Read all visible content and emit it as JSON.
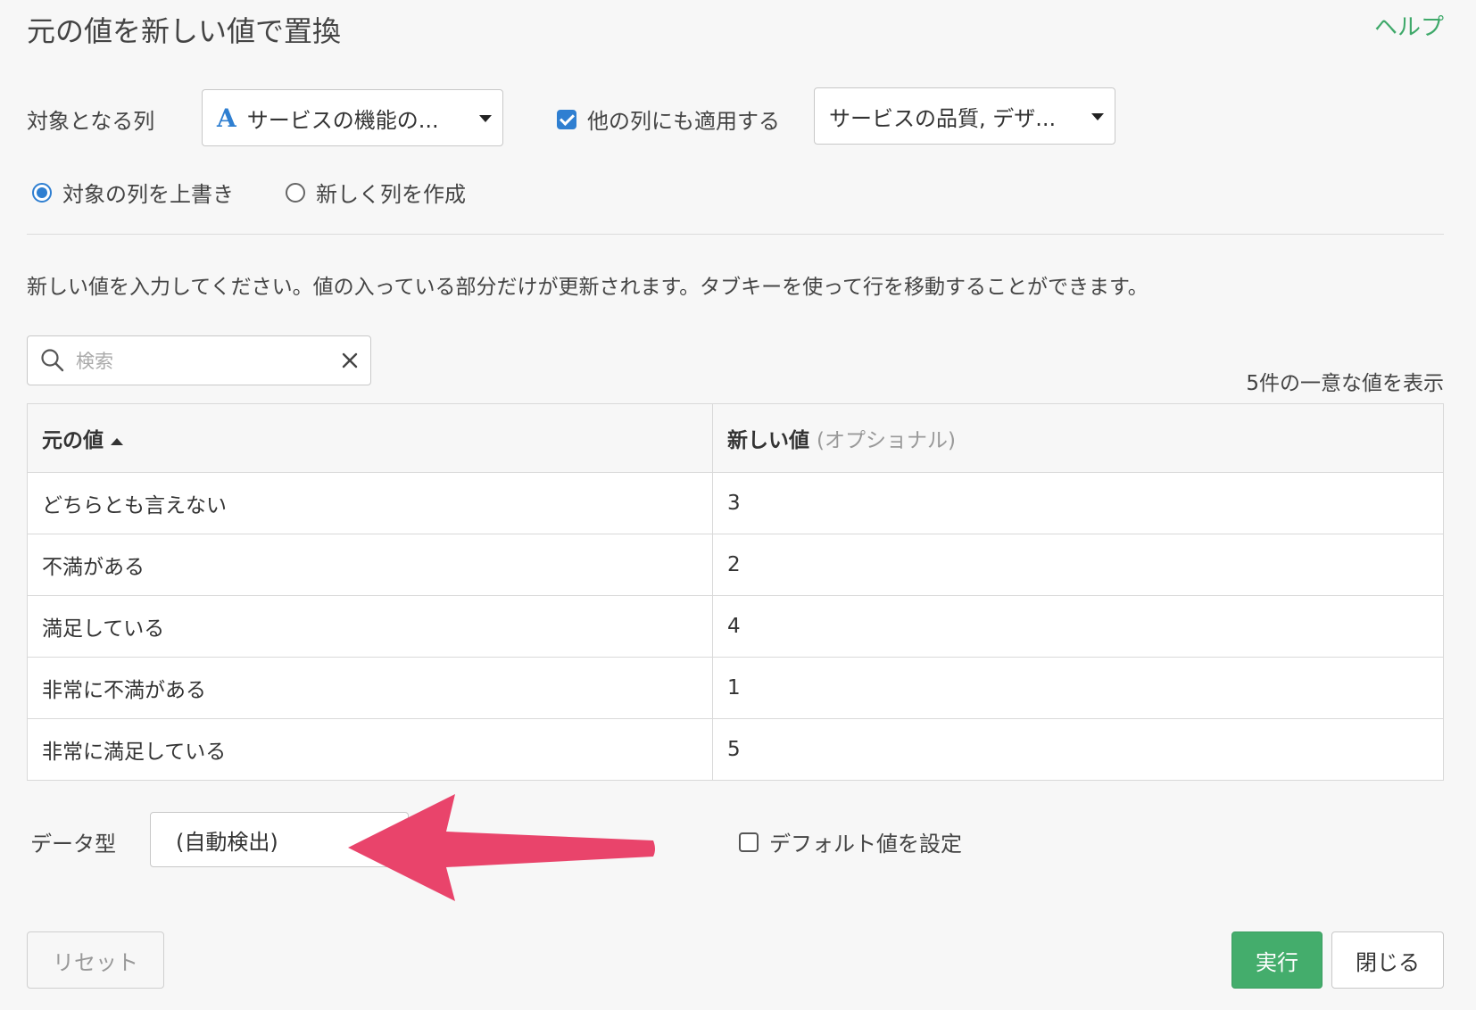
{
  "dialog": {
    "title": "元の値を新しい値で置換",
    "help_label": "ヘルプ"
  },
  "target": {
    "label": "対象となる列",
    "column_type_icon": "A",
    "column_value": "サービスの機能の...",
    "apply_other_checked": true,
    "apply_other_label": "他の列にも適用する",
    "other_columns_value": "サービスの品質, デザ..."
  },
  "output_mode": {
    "overwrite_label": "対象の列を上書き",
    "new_column_label": "新しく列を作成",
    "selected": "overwrite"
  },
  "instructions": "新しい値を入力してください。値の入っている部分だけが更新されます。タブキーを使って行を移動することができます。",
  "search": {
    "placeholder": "検索",
    "value": ""
  },
  "unique_count_text": "5件の一意な値を表示",
  "table": {
    "col_original": "元の値",
    "col_new": "新しい値",
    "col_new_note": "(オプショナル)",
    "rows": [
      {
        "original": "どちらとも言えない",
        "new": "3"
      },
      {
        "original": "不満がある",
        "new": "2"
      },
      {
        "original": "満足している",
        "new": "4"
      },
      {
        "original": "非常に不満がある",
        "new": "1"
      },
      {
        "original": "非常に満足している",
        "new": "5"
      }
    ]
  },
  "data_type": {
    "label": "データ型",
    "value": "(自動検出)"
  },
  "default_value": {
    "checked": false,
    "label": "デフォルト値を設定"
  },
  "buttons": {
    "reset": "リセット",
    "run": "実行",
    "close": "閉じる"
  },
  "colors": {
    "accent_blue": "#2f7fd1",
    "success_green": "#44ad6c",
    "help_green": "#3fa96a",
    "annotation_arrow": "#e9446b"
  },
  "icons": {
    "search": "search-icon",
    "clear": "close-icon",
    "dropdown": "caret-down-icon",
    "sort": "sort-asc-icon",
    "annotation": "arrow-left-icon"
  }
}
